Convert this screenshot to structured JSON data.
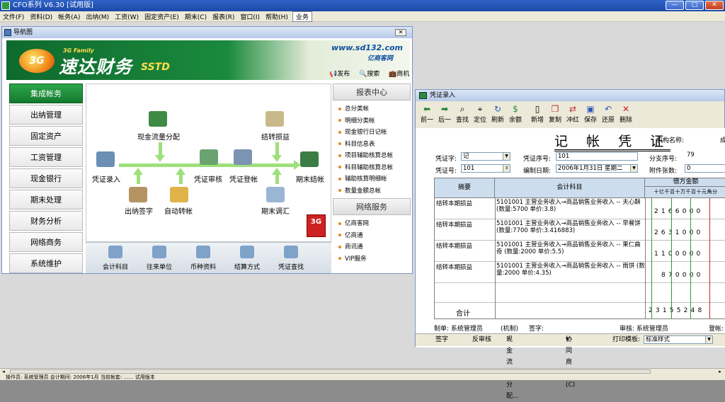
{
  "app": {
    "title": "CFO系列 V6.30 [试用版]"
  },
  "menu": [
    "文件(F)",
    "资料(D)",
    "帐务(A)",
    "出纳(M)",
    "工资(W)",
    "固定资产(E)",
    "期末(C)",
    "报表(R)",
    "窗口(I)",
    "帮助(H)"
  ],
  "menu_biz": "业务",
  "window_buttons": {
    "min": "—",
    "max": "□",
    "close": "✕"
  },
  "nav": {
    "title": "导航图",
    "banner": {
      "family": "3G Family",
      "brand": "速达财务",
      "product": "SSTD",
      "url": "www.sd132.com",
      "subtitle": "亿商客网",
      "logo": "3G",
      "links": [
        "发布",
        "搜索",
        "商机"
      ]
    },
    "sidebar": [
      "集成帐务",
      "出纳管理",
      "固定资产",
      "工资管理",
      "现金银行",
      "期末处理",
      "财务分析",
      "网络商务",
      "系统维护"
    ],
    "flow": {
      "cash_flow": "现金流量分配",
      "carry_pl": "结转损益",
      "voucher_entry": "凭证录入",
      "voucher_audit": "凭证审核",
      "voucher_post": "凭证登帐",
      "period_close": "期末结帐",
      "cashier_sign": "出纳签字",
      "auto_transfer": "自动转帐",
      "period_adjust": "期末调汇"
    },
    "bottom": [
      "会计科目",
      "往来单位",
      "币种资料",
      "结算方式",
      "凭证查找"
    ],
    "reports": {
      "title": "报表中心",
      "items": [
        "总分类帐",
        "明细分类帐",
        "现金银行日记帐",
        "科目信息表",
        "项目辅助核算总帐",
        "科目辅助核算总帐",
        "辅助核算明细帐",
        "数量金额总帐"
      ]
    },
    "network": {
      "title": "网络服务",
      "items": [
        "亿商客网",
        "亿商通",
        "商讯通",
        "VIP服务"
      ]
    },
    "badge": "3G"
  },
  "voucher": {
    "title": "凭证录入",
    "toolbar": [
      "前一",
      "后一",
      "查找",
      "定位",
      "刷新",
      "余额",
      "新增",
      "复制",
      "冲红",
      "保存",
      "还原",
      "删除"
    ],
    "heading": "记 帐 凭 证",
    "org_label": "机构名称:",
    "org_value": "成",
    "word_label": "凭证字:",
    "word_value": "记",
    "seq_label": "凭证序号:",
    "seq_value": "101",
    "branch_label": "分支序号:",
    "branch_value": "79",
    "no_label": "凭证号:",
    "no_value": "101",
    "date_label": "编制日期:",
    "date_value": "2006年1月31日 星期二",
    "attach_label": "附件张数:",
    "attach_value": "0",
    "col_summary": "摘要",
    "col_account": "会计科目",
    "col_debit": "借方金额",
    "digit_heads": [
      "十",
      "亿",
      "千",
      "百",
      "十",
      "万",
      "千",
      "百",
      "十",
      "元",
      "角",
      "分"
    ],
    "rows": [
      {
        "summary": "结转本期损益",
        "account": "5101001  主营业务收入→商品销售业务收入 -- 夫心酥 (数量:5700 单价:3.8)",
        "amount": "2166000"
      },
      {
        "summary": "结转本期损益",
        "account": "5101001  主营业务收入→商品销售业务收入 -- 早餐饼 (数量:7700 单价:3.416883)",
        "amount": "2631000"
      },
      {
        "summary": "结转本期损益",
        "account": "5101001  主营业务收入→商品销售业务收入 -- 果仁曲奇 (数量:2000 单价:5.5)",
        "amount": "1100000"
      },
      {
        "summary": "结转本期损益",
        "account": "5101001  主营业务收入→商品销售业务收入 -- 雨饼 (数量:2000 单价:4.35)",
        "amount": "870000"
      }
    ],
    "total_label": "合计",
    "total_amount": "23155248",
    "footer": {
      "maker": "制单: 系统管理员",
      "mech": "(机制)",
      "signer": "签字:",
      "auditor": "审核: 系统管理员",
      "poster": "登帐:"
    },
    "bottom": {
      "sign": "签字",
      "unaudit": "反审核",
      "cashflow": "现金流量分配...",
      "collab": "协同商务(C)",
      "print_label": "打印模板:",
      "print_value": "标准样式"
    }
  },
  "status": "操作员: 系统管理员     会计期间: 2006年1月     当前帐套: ……     试用版本"
}
